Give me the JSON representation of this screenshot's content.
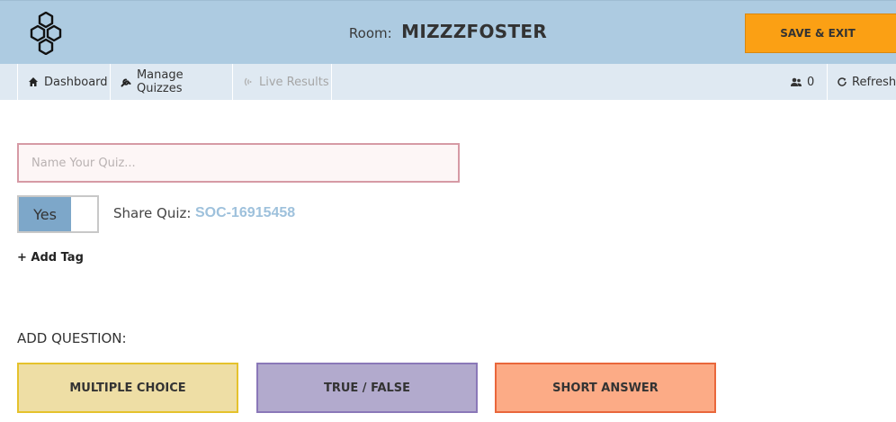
{
  "header": {
    "room_label": "Room:",
    "room_name": "MIZZZFOSTER",
    "save_exit_label": "SAVE & EXIT",
    "logo_icon": "hexagon-cluster-logo"
  },
  "nav": {
    "dashboard": {
      "label": "Dashboard",
      "icon": "home-icon"
    },
    "manage_quizzes": {
      "label": "Manage Quizzes",
      "icon": "wrench-icon"
    },
    "live_results": {
      "label": "Live Results",
      "icon": "broadcast-icon",
      "disabled": true
    },
    "users": {
      "count": "0",
      "icon": "users-icon"
    },
    "refresh": {
      "label": "Refresh",
      "icon": "refresh-icon"
    }
  },
  "quiz": {
    "name_placeholder": "Name Your Quiz...",
    "name_value": "",
    "share_toggle_label": "Yes",
    "share_label": "Share Quiz:",
    "share_code": "SOC-16915458",
    "add_tag_label": "+ Add Tag"
  },
  "questions": {
    "section_label": "ADD QUESTION:",
    "multiple_choice_label": "MULTIPLE CHOICE",
    "true_false_label": "TRUE / FALSE",
    "short_answer_label": "SHORT ANSWER"
  },
  "colors": {
    "header_bg": "#adcbe1",
    "nav_bg": "#dfe9f2",
    "save_exit_bg": "#fba014",
    "toggle_on": "#7da7c9",
    "share_code": "#9ec1dc",
    "multiple_choice": "#eedea5",
    "true_false": "#b2aacd",
    "short_answer": "#fcab86"
  }
}
